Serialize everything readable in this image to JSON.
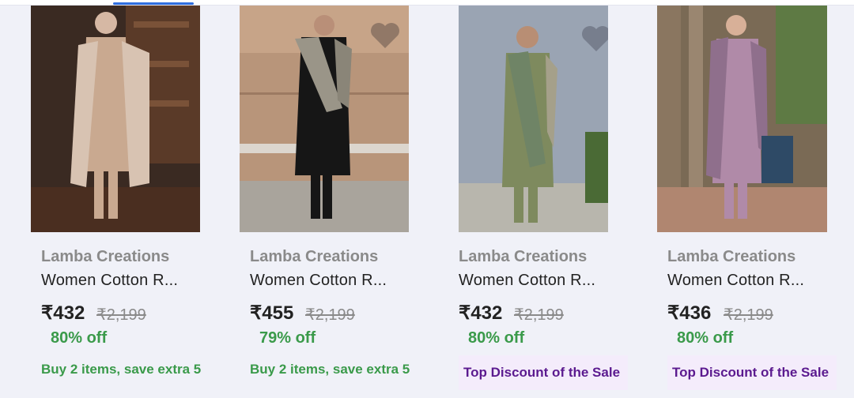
{
  "products": [
    {
      "brand": "Lamba Creations",
      "title": "Women Cotton R...",
      "price": "₹432",
      "mrp": "₹2,199",
      "discount": "80% off",
      "promo": "Buy 2 items, save extra 5",
      "badge": "",
      "colors": {
        "bg": "#3a2a22",
        "outfit": "#c9a990",
        "dupatta": "#d8c3b2"
      }
    },
    {
      "brand": "Lamba Creations",
      "title": "Women Cotton R...",
      "price": "₹455",
      "mrp": "₹2,199",
      "discount": "79% off",
      "promo": "Buy 2 items, save extra 5",
      "badge": "",
      "colors": {
        "bg": "#b8957a",
        "outfit": "#161616",
        "dupatta": "#9a9588"
      }
    },
    {
      "brand": "Lamba Creations",
      "title": "Women Cotton R...",
      "price": "₹432",
      "mrp": "₹2,199",
      "discount": "80% off",
      "promo": "",
      "badge": "Top Discount of the Sale",
      "colors": {
        "bg": "#9aa4b3",
        "outfit": "#7e8a5e",
        "dupatta": "#6f8466"
      }
    },
    {
      "brand": "Lamba Creations",
      "title": "Women Cotton R...",
      "price": "₹436",
      "mrp": "₹2,199",
      "discount": "80% off",
      "promo": "",
      "badge": "Top Discount of the Sale",
      "colors": {
        "bg": "#7a6a55",
        "outfit": "#b08aa8",
        "dupatta": "#8f6f8c"
      }
    }
  ],
  "icons": {
    "wishlist": "heart-icon"
  },
  "theme": {
    "accent": "#2f6fe0",
    "discount_green": "#3a9a4a",
    "badge_bg": "#f4ecfb",
    "badge_text": "#5b1a8f"
  }
}
